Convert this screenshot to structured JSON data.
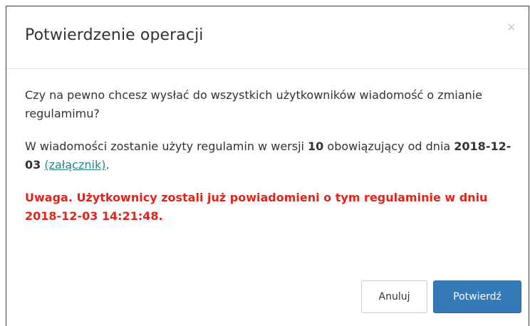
{
  "dialog": {
    "title": "Potwierdzenie operacji",
    "close_symbol": "×",
    "question": "Czy na pewno chcesz wysłać do wszystkich użytkowników wiadomość o zmianie regulamimu?",
    "info_prefix": "W wiadomości zostanie użyty regulamin w wersji ",
    "version": "10",
    "info_middle": " obowiązujący od dnia ",
    "date": "2018-12-03",
    "info_space": " ",
    "attachment_link": "(załącznik)",
    "info_suffix": ".",
    "warning": "Uwaga. Użytkownicy zostali już powiadomieni o tym regulaminie w dniu 2018-12-03 14:21:48.",
    "cancel_label": "Anuluj",
    "confirm_label": "Potwierdź"
  },
  "colors": {
    "primary": "#337ab7",
    "warning": "#e2231a",
    "link": "#2c8585"
  }
}
